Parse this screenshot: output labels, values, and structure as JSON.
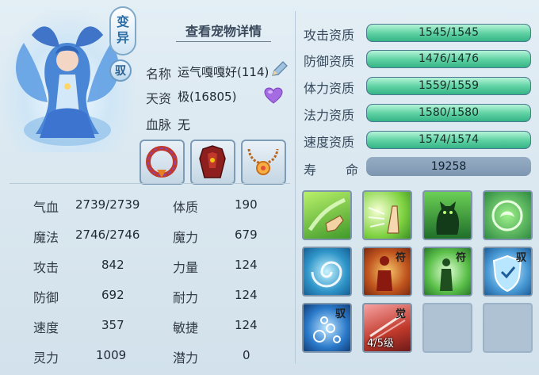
{
  "header": {
    "mutant_tag": "变异",
    "tame_tag": "驭",
    "details_link": "查看宠物详情"
  },
  "info": {
    "name_label": "名称",
    "name_value": "运气嘎嘎好(114)",
    "aptitude_label": "天资",
    "aptitude_value": "极(16805)",
    "bloodline_label": "血脉",
    "bloodline_value": "无"
  },
  "stats": [
    {
      "label": "气血",
      "value": "2739/2739",
      "label2": "体质",
      "value2": "190"
    },
    {
      "label": "魔法",
      "value": "2746/2746",
      "label2": "魔力",
      "value2": "679"
    },
    {
      "label": "攻击",
      "value": "842",
      "label2": "力量",
      "value2": "124"
    },
    {
      "label": "防御",
      "value": "692",
      "label2": "耐力",
      "value2": "124"
    },
    {
      "label": "速度",
      "value": "357",
      "label2": "敏捷",
      "value2": "124"
    },
    {
      "label": "灵力",
      "value": "1009",
      "label2": "潜力",
      "value2": "0"
    }
  ],
  "aptitudes": [
    {
      "label": "攻击资质",
      "value": "1545/1545",
      "fill": 1.0
    },
    {
      "label": "防御资质",
      "value": "1476/1476",
      "fill": 1.0
    },
    {
      "label": "体力资质",
      "value": "1559/1559",
      "fill": 1.0
    },
    {
      "label": "法力资质",
      "value": "1580/1580",
      "fill": 1.0
    },
    {
      "label": "速度资质",
      "value": "1574/1574",
      "fill": 1.0
    }
  ],
  "lifespan": {
    "label_a": "寿",
    "label_b": "命",
    "value": "19258"
  },
  "skills": {
    "badge_fu": "符",
    "badge_yu": "驭",
    "badge_jue": "觉",
    "awaken_level": "4/5级"
  },
  "colors": {
    "bar_fill": "#4fcb9c",
    "bar_track": "#315a73",
    "lifespan_bar": "#8aa3bb"
  }
}
